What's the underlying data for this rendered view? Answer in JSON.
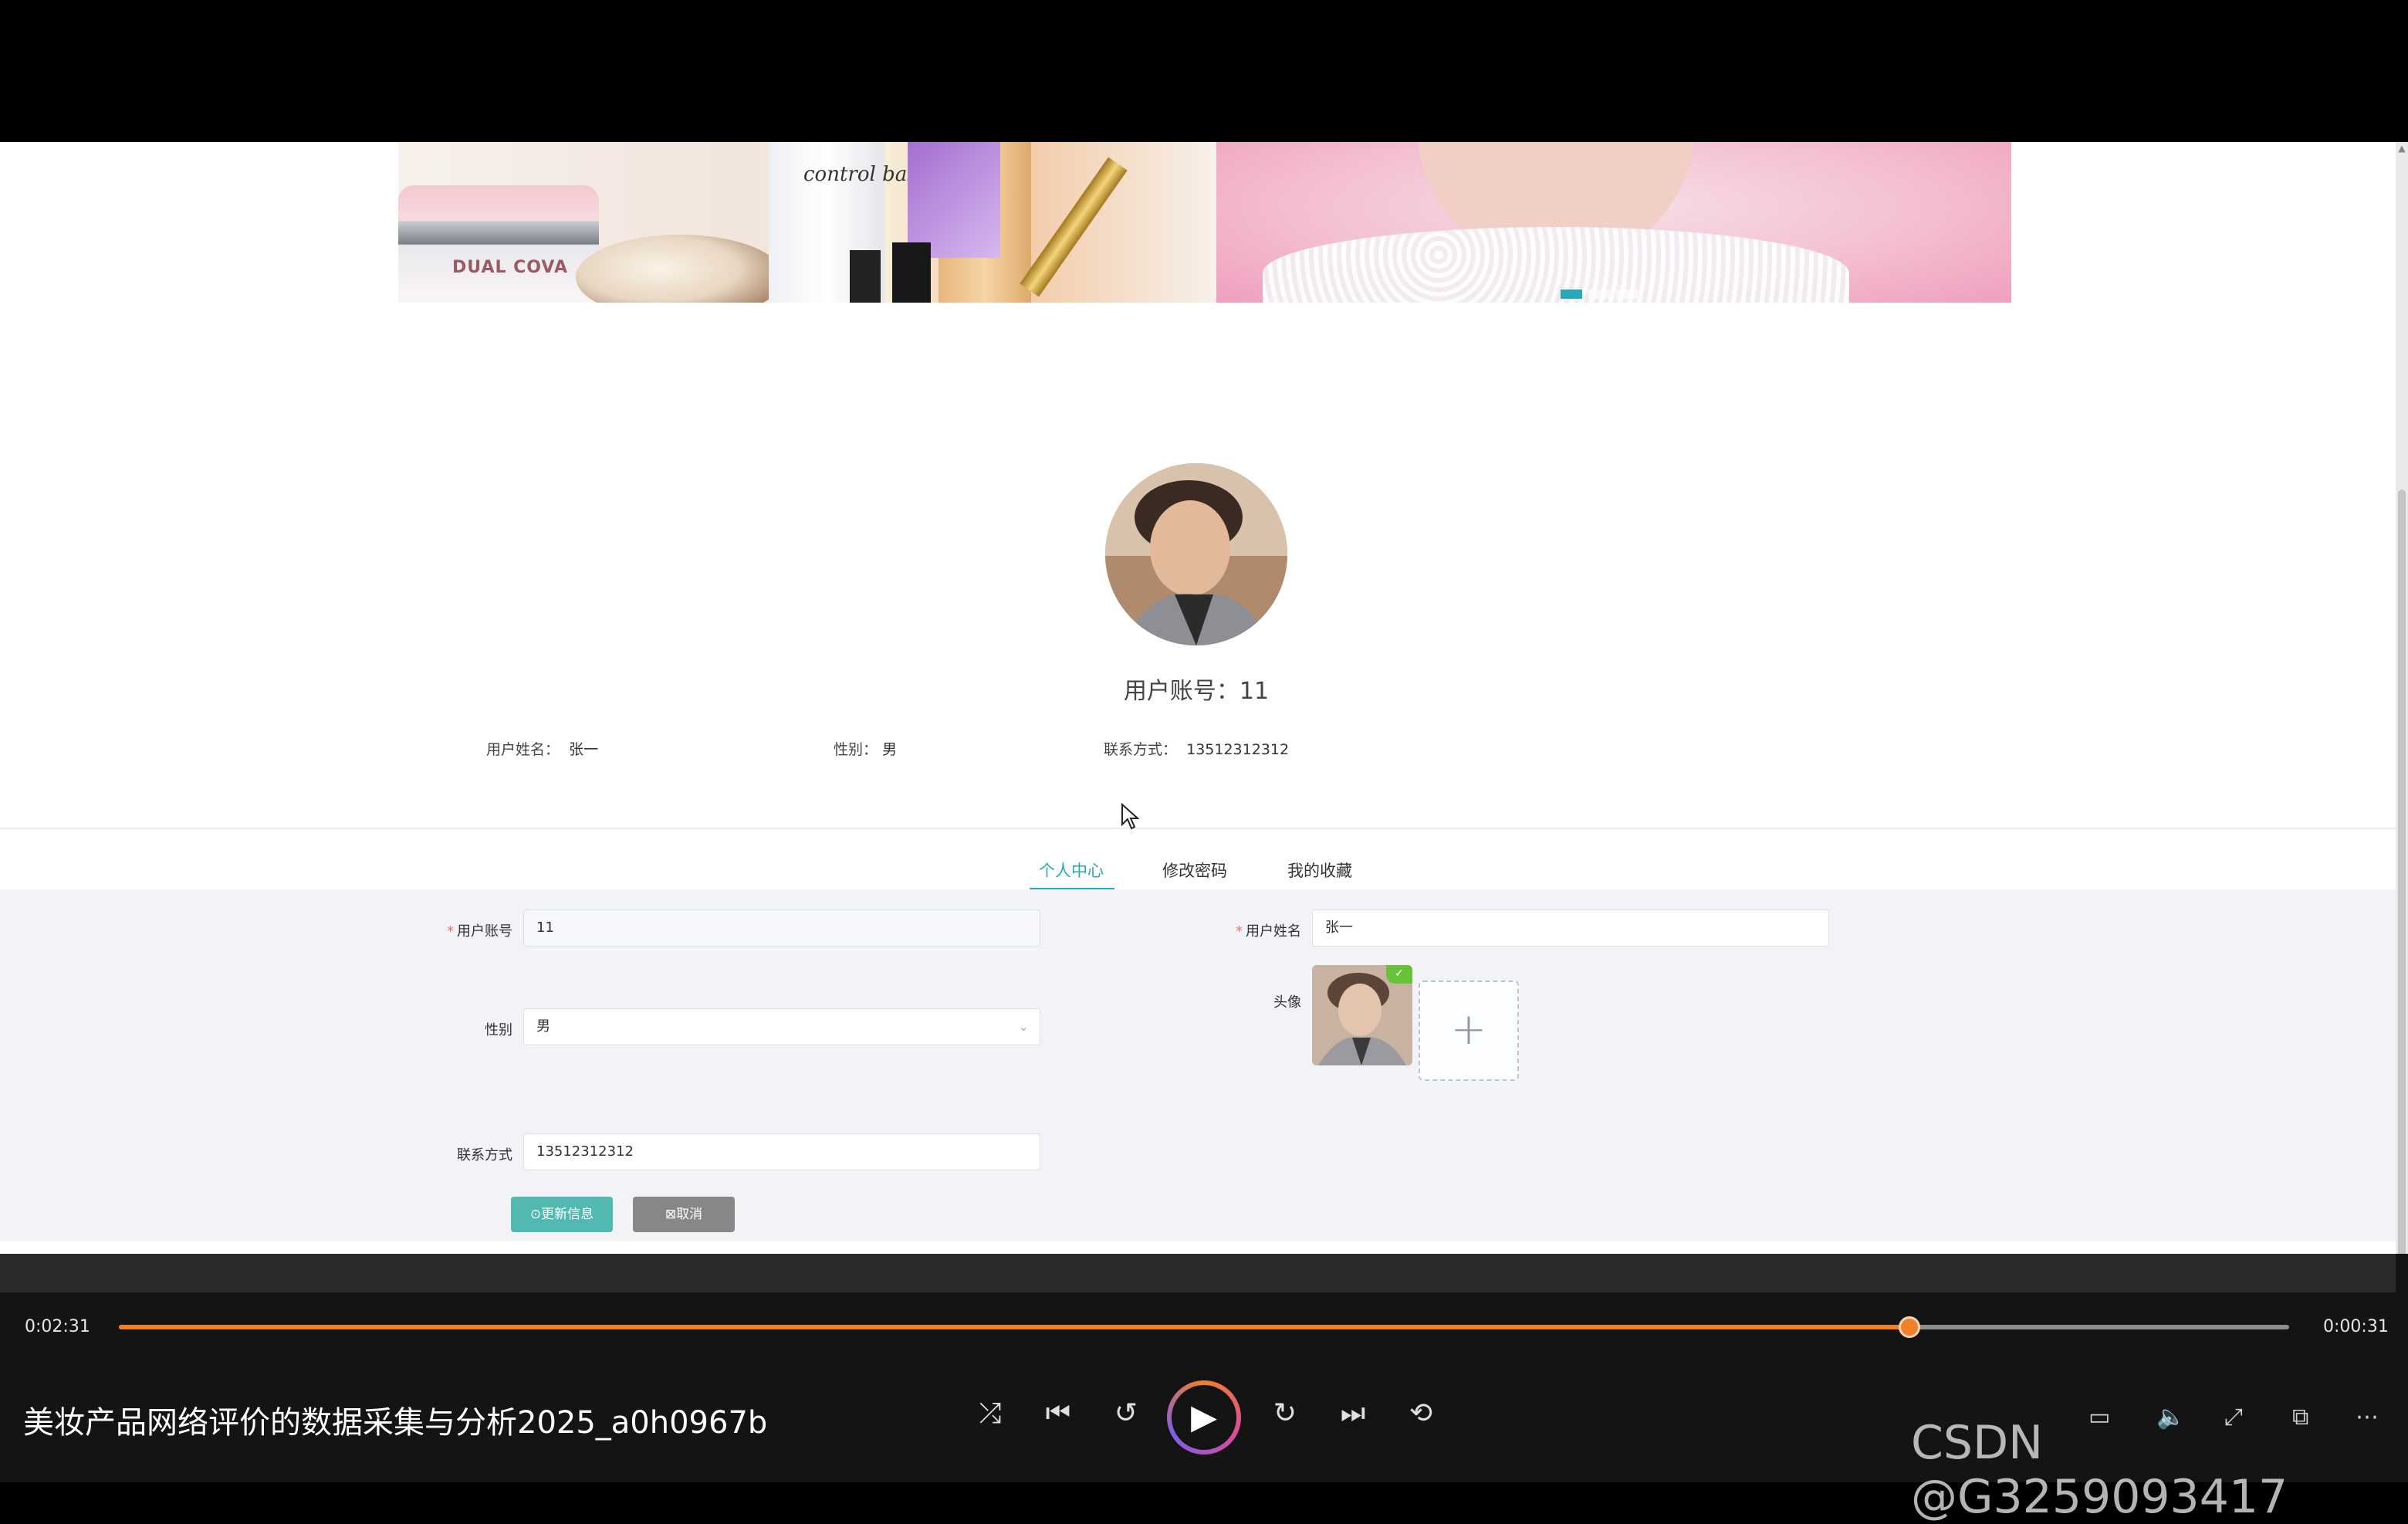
{
  "banner": {
    "jar_text": "DUAL COVA",
    "bottle_text": "control base"
  },
  "profile": {
    "account_label": "用户账号：",
    "account_value": "11",
    "name_label": "用户姓名：",
    "name_value": "张一",
    "gender_label": "性别：",
    "gender_value": "男",
    "phone_label": "联系方式：",
    "phone_value": "13512312312"
  },
  "tabs": [
    {
      "label": "个人中心",
      "active": true
    },
    {
      "label": "修改密码",
      "active": false
    },
    {
      "label": "我的收藏",
      "active": false
    }
  ],
  "form": {
    "account_label": "用户账号",
    "account_value": "11",
    "name_label": "用户姓名",
    "name_value": "张一",
    "gender_label": "性别",
    "gender_value": "男",
    "avatar_label": "头像",
    "phone_label": "联系方式",
    "phone_value": "13512312312",
    "update_button": "⊙更新信息",
    "cancel_button": "⊠取消"
  },
  "player": {
    "current_time": "0:02:31",
    "remaining_time": "0:00:31",
    "progress": 0.825,
    "title": "美妆产品网络评价的数据采集与分析2025_a0h0967b",
    "accent_color": "#f27f2a"
  },
  "watermark": "CSDN @G3259093417",
  "colors": {
    "accent": "#28a9b7",
    "update_button": "#51b9b0",
    "cancel_button": "#878787"
  }
}
